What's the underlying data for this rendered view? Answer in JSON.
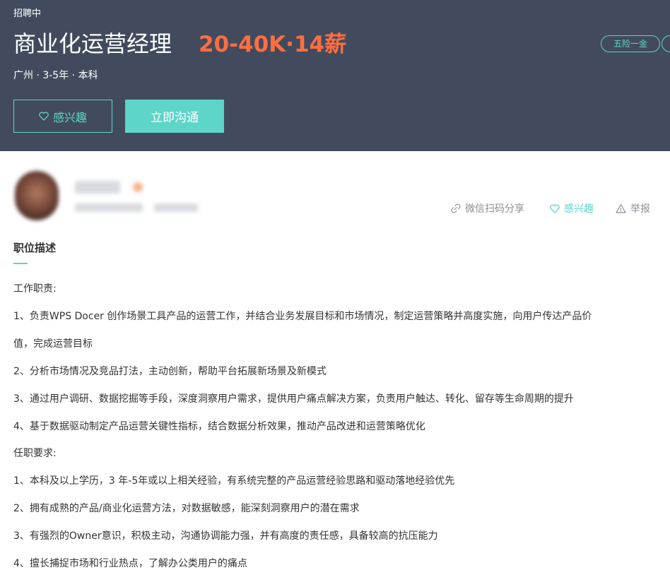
{
  "job": {
    "status": "招聘中",
    "title": "商业化运营经理",
    "salary": "20-40K·14薪",
    "meta": "广州 · 3-5年 · 本科",
    "benefit": "五险一金"
  },
  "buttons": {
    "interest": "感兴趣",
    "chat": "立即沟通"
  },
  "actions": {
    "share": "微信扫码分享",
    "interest": "感兴趣",
    "report": "举报"
  },
  "section": {
    "title": "职位描述"
  },
  "description": {
    "duties_heading": "工作职责:",
    "duties": [
      "1、负责WPS Docer 创作场景工具产品的运营工作，并结合业务发展目标和市场情况，制定运营策略并高度实施，向用户传达产品价",
      "值，完成运营目标",
      "2、分析市场情况及竞品打法，主动创新，帮助平台拓展新场景及新模式",
      "3、通过用户调研、数据挖掘等手段，深度洞察用户需求，提供用户痛点解决方案，负责用户触达、转化、留存等生命周期的提升",
      "4、基于数据驱动制定产品运营关键性指标，结合数据分析效果，推动产品改进和运营策略优化"
    ],
    "requirements_heading": "任职要求:",
    "requirements": [
      "1、本科及以上学历，3 年-5年或以上相关经验，有系统完整的产品运营经验思路和驱动落地经验优先",
      "2、拥有成熟的产品/商业化运营方法，对数据敏感，能深刻洞察用户的潜在需求",
      "3、有强烈的Owner意识，积极主动，沟通协调能力强，并有高度的责任感，具备较高的抗压能力",
      "4、擅长捕捉市场和行业热点，了解办公类用户的痛点"
    ]
  },
  "colors": {
    "header_bg": "#424b5e",
    "accent": "#5dd5c8",
    "salary": "#ff6e40"
  },
  "icons": [
    "heart-icon",
    "link-icon",
    "warning-icon"
  ]
}
